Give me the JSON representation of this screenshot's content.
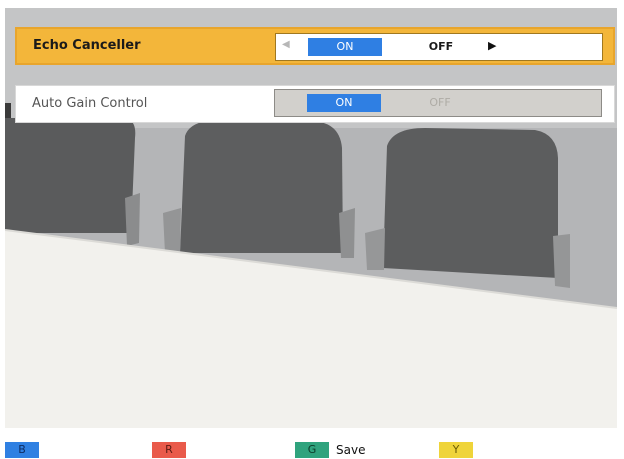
{
  "settings": [
    {
      "label": "Echo Canceller",
      "on_label": "ON",
      "off_label": "OFF",
      "selected": "ON",
      "focused": true
    },
    {
      "label": "Auto Gain Control",
      "on_label": "ON",
      "off_label": "OFF",
      "selected": "ON",
      "focused": false
    }
  ],
  "footer": {
    "blue_key": "B",
    "red_key": "R",
    "green_key": "G",
    "green_action": "Save",
    "yellow_key": "Y"
  },
  "colors": {
    "focus_row": "#f3b63a",
    "selected_option": "#2f7fe3",
    "blue": "#2f80e2",
    "red": "#e95a4a",
    "green": "#2fa37d",
    "yellow": "#efd43a"
  },
  "icons": {
    "prev_option": "left-triangle",
    "next_option": "right-triangle"
  }
}
